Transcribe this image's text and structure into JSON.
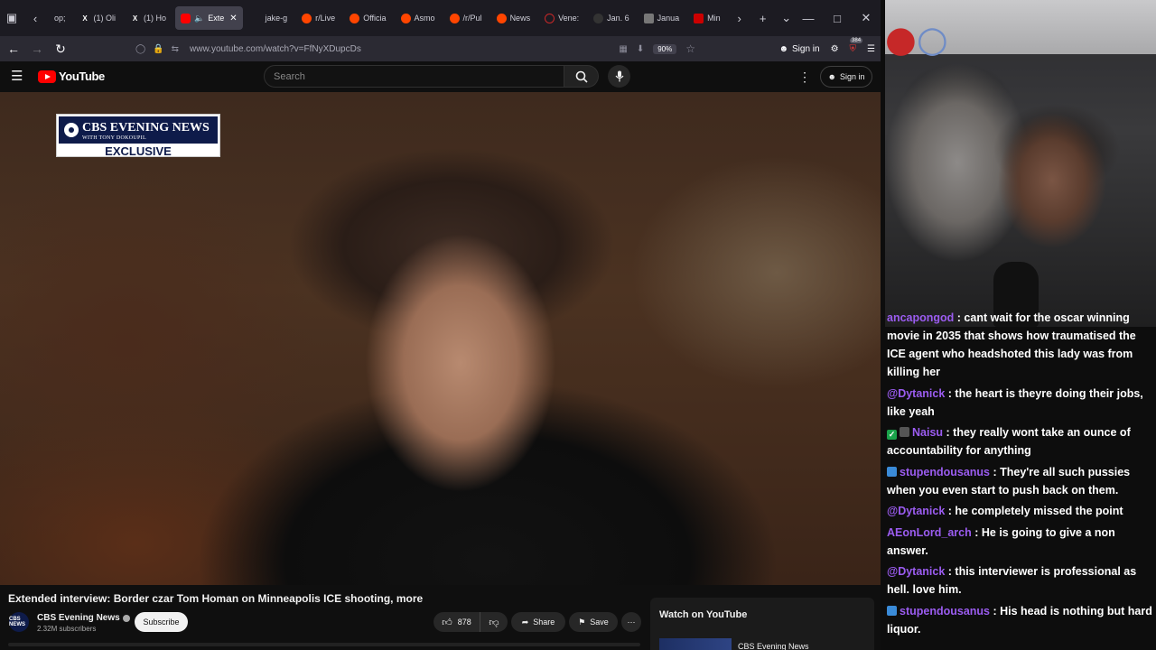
{
  "browser": {
    "tabs": [
      {
        "label": "op;",
        "icon": "chevron-icon",
        "active": false
      },
      {
        "label": "(1) Oli",
        "icon": "x-logo",
        "active": false
      },
      {
        "label": "(1) Ho",
        "icon": "x-logo",
        "active": false
      },
      {
        "label": "Exte",
        "icon": "youtube-icon",
        "active": true
      },
      {
        "label": "jake-g",
        "icon": "page-icon",
        "active": false
      },
      {
        "label": "r/Live",
        "icon": "reddit-icon",
        "active": false
      },
      {
        "label": "Officia",
        "icon": "reddit-icon",
        "active": false
      },
      {
        "label": "Asmo",
        "icon": "reddit-icon",
        "active": false
      },
      {
        "label": "/r/Pul",
        "icon": "reddit-icon",
        "active": false
      },
      {
        "label": "News",
        "icon": "reddit-icon",
        "active": false
      },
      {
        "label": "Vene:",
        "icon": "globe-icon",
        "active": false
      },
      {
        "label": "Jan. 6",
        "icon": "abc-icon",
        "active": false
      },
      {
        "label": "Janua",
        "icon": "building-icon",
        "active": false
      },
      {
        "label": "Min",
        "icon": "cnn-icon",
        "active": false
      }
    ],
    "url": "www.youtube.com/watch?v=FfNyXDupcDs",
    "zoom": "90%",
    "signin_label": "Sign in",
    "extension_badge": "384"
  },
  "youtube": {
    "logo": "YouTube",
    "search_placeholder": "Search",
    "signin_label": "Sign in",
    "video": {
      "overlay_brand": "CBS EVENING NEWS",
      "overlay_subbrand": "WITH TONY DOKOUPIL",
      "overlay_tag": "EXCLUSIVE"
    },
    "title": "Extended interview: Border czar Tom Homan on Minneapolis ICE shooting, more",
    "channel": {
      "avatar_text": "CBS NEWS",
      "name": "CBS Evening News",
      "subscribers": "2.32M subscribers",
      "subscribe_label": "Subscribe"
    },
    "actions": {
      "likes": "878",
      "share_label": "Share",
      "save_label": "Save"
    },
    "side_panel": {
      "title": "Watch on YouTube",
      "channel": "CBS Evening News"
    }
  },
  "stream": {
    "chat": [
      {
        "user": "ancapongod",
        "user_color": "#9b5cf0",
        "badge": "",
        "text": "cant wait for the oscar winning movie in 2035 that shows how traumatised the ICE agent who headshoted this lady was from killing her"
      },
      {
        "user": "@Dytanick",
        "user_color": "#9b5cf0",
        "badge": "",
        "text": "the heart is theyre doing their jobs, like yeah"
      },
      {
        "user": "Naisu",
        "user_color": "#9b5cf0",
        "badge": "check",
        "text": "they really wont take an ounce of accountability for anything"
      },
      {
        "user": "stupendousanus",
        "user_color": "#9b5cf0",
        "badge": "sub",
        "text": "They're all such pussies when you even start to push back on them."
      },
      {
        "user": "@Dytanick",
        "user_color": "#9b5cf0",
        "badge": "",
        "text": "he completely missed the point"
      },
      {
        "user": "AEonLord_arch",
        "user_color": "#9b5cf0",
        "badge": "",
        "text": "He is going to give a non answer."
      },
      {
        "user": "@Dytanick",
        "user_color": "#9b5cf0",
        "badge": "",
        "text": "this interviewer is professional as hell. love him."
      },
      {
        "user": "stupendousanus",
        "user_color": "#9b5cf0",
        "badge": "sub",
        "text": "His head is nothing but hard liquor."
      }
    ]
  },
  "colors": {
    "youtube_red": "#ff0000",
    "cbs_navy": "#0e1b4a",
    "chat_username": "#9b5cf0",
    "browser_tabbar": "#1c1b22"
  }
}
